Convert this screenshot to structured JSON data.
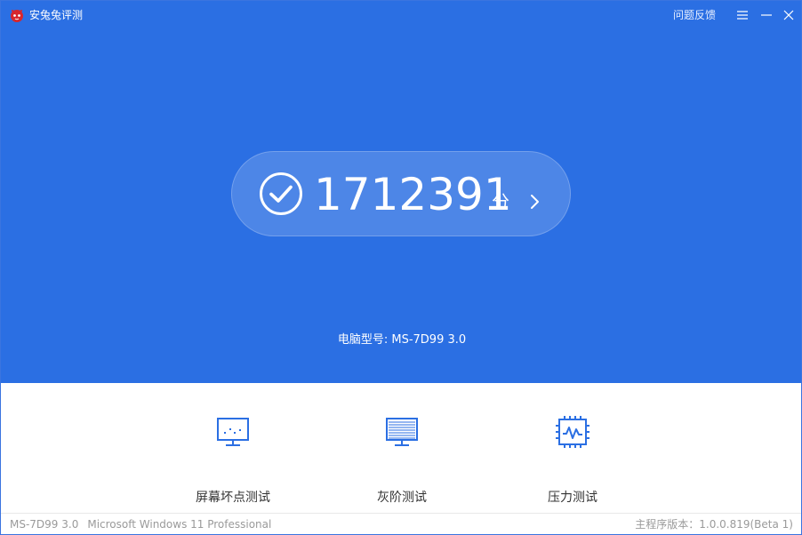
{
  "app": {
    "title": "安兔兔评测",
    "feedback_label": "问题反馈"
  },
  "window_controls": {
    "menu_icon": "menu-icon",
    "minimize_icon": "minimize-icon",
    "close_icon": "close-icon"
  },
  "score": {
    "value": "1712391",
    "unit": "分"
  },
  "device": {
    "model_line": "电脑型号: MS-7D99 3.0"
  },
  "tools": [
    {
      "label": "屏幕坏点测试",
      "icon": "monitor-dead-pixel-icon"
    },
    {
      "label": "灰阶测试",
      "icon": "grayscale-monitor-icon"
    },
    {
      "label": "压力测试",
      "icon": "cpu-stress-icon"
    }
  ],
  "status": {
    "model": "MS-7D99 3.0",
    "os": "Microsoft Windows 11 Professional",
    "version": "主程序版本：1.0.0.819(Beta 1)"
  },
  "colors": {
    "header_bg": "#2b6fe3",
    "tool_icon": "#2b6fe3",
    "status_text": "#9a9a9a"
  }
}
